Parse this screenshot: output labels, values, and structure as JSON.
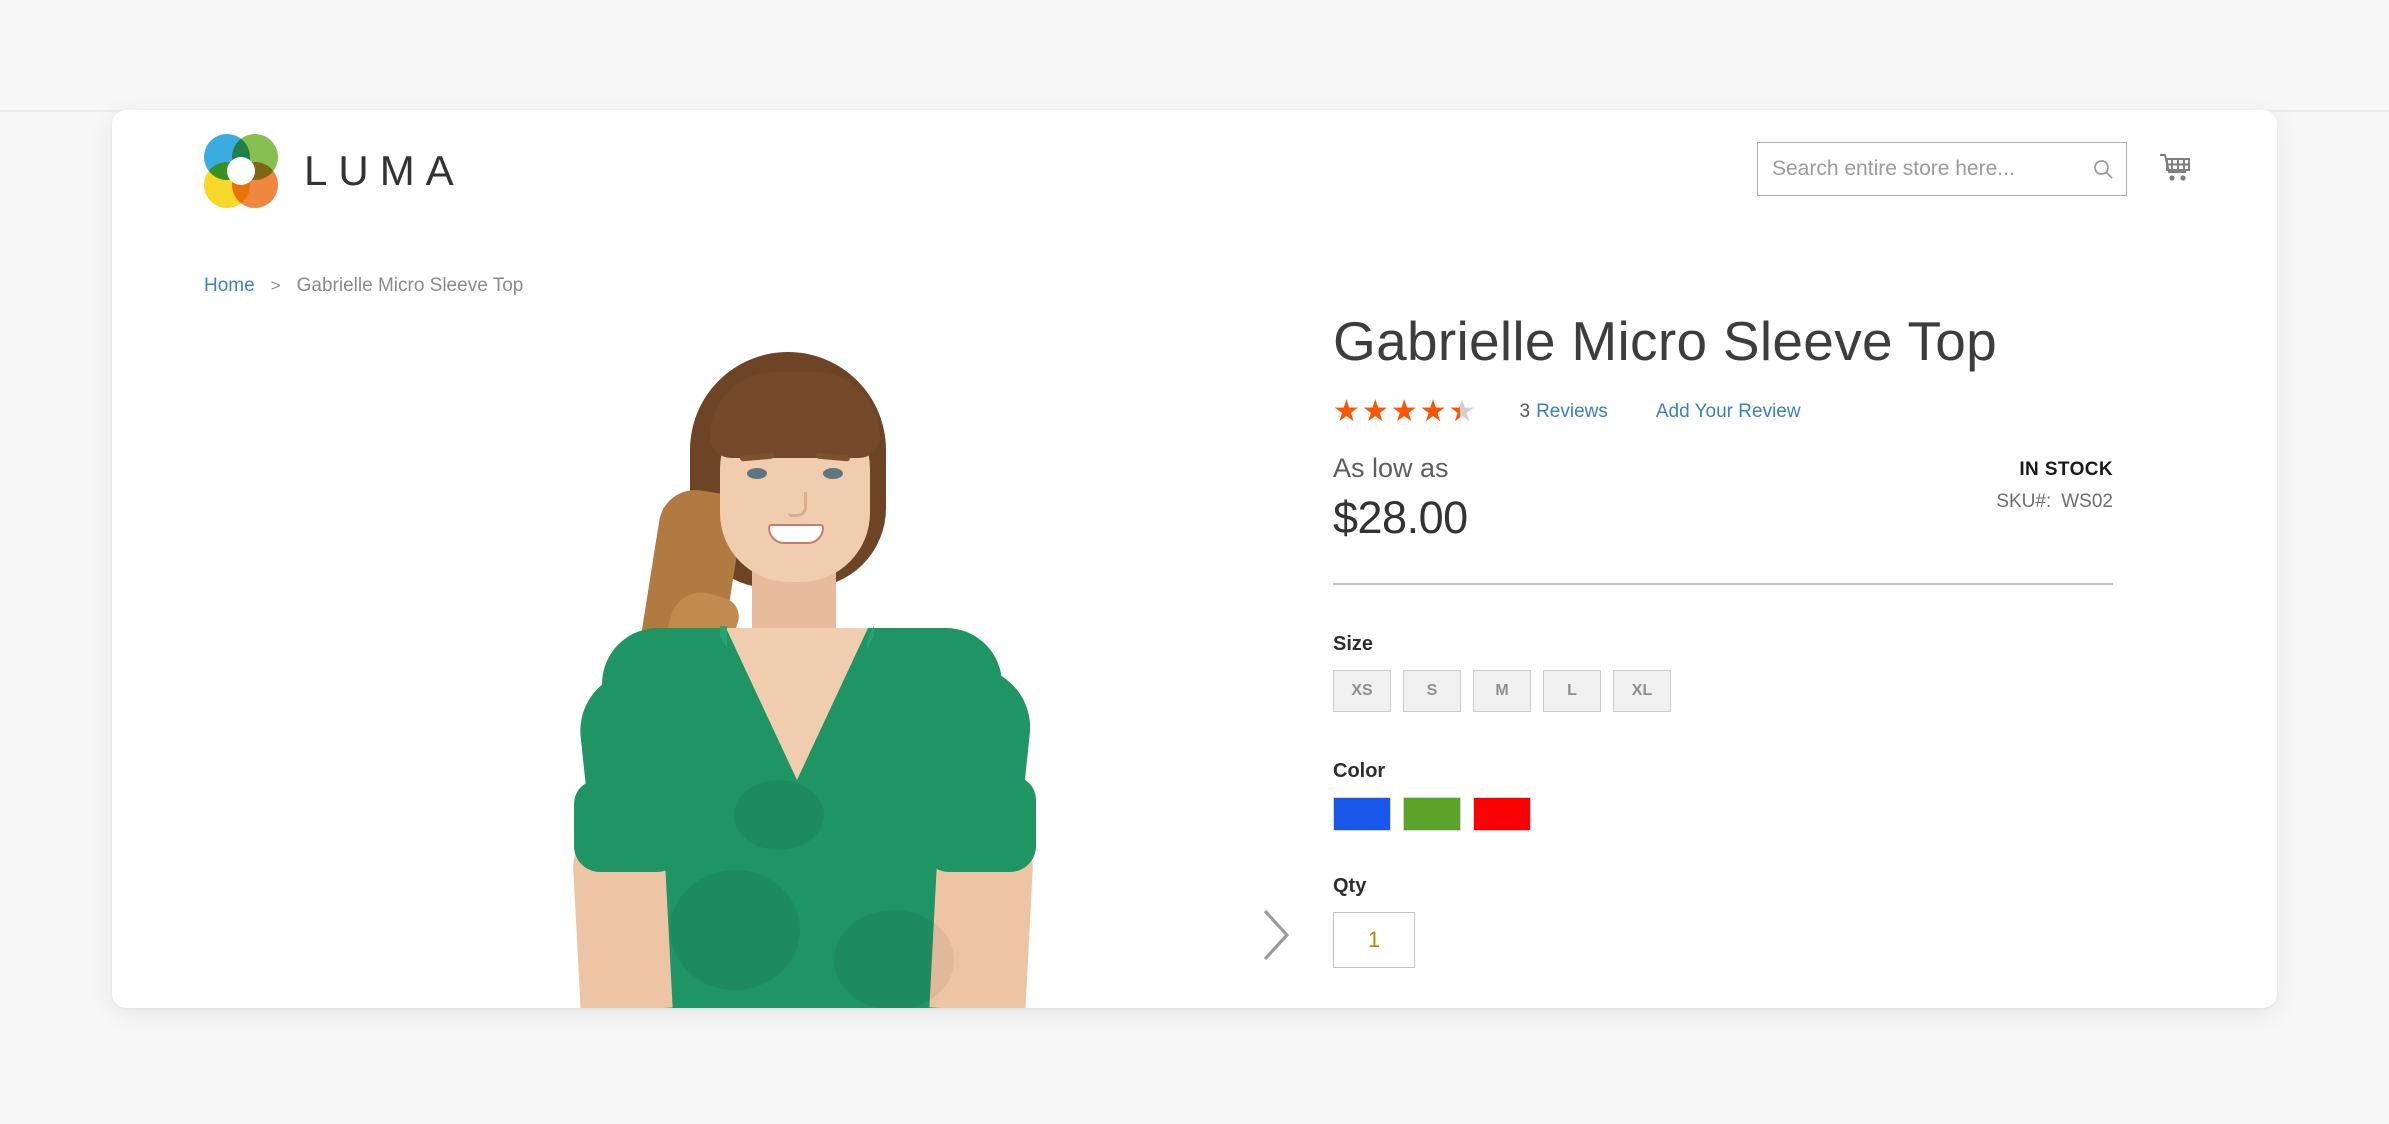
{
  "header": {
    "brand_name": "LUMA",
    "logo_colors": {
      "blue": "#2ba6df",
      "green": "#7ebb42",
      "yellow": "#f7d417",
      "orange": "#ef7e31"
    },
    "search": {
      "placeholder": "Search entire store here...",
      "value": ""
    },
    "cart_label": "Shopping Cart"
  },
  "breadcrumb": {
    "home": "Home",
    "separator": ">",
    "current": "Gabrielle Micro Sleeve Top"
  },
  "gallery": {
    "next_label": "Next image",
    "shirt_color": "#1f9464"
  },
  "product": {
    "title": "Gabrielle Micro Sleeve Top",
    "rating_percent": 88,
    "stars_glyphs": "★★★★★",
    "review_count": "3",
    "review_label": "Reviews",
    "add_review": "Add Your Review",
    "price_prefix": "As low as",
    "price": "$28.00",
    "stock_status": "IN STOCK",
    "sku_label": "SKU#:",
    "sku_value": "WS02"
  },
  "options": {
    "size_label": "Size",
    "sizes": [
      "XS",
      "S",
      "M",
      "L",
      "XL"
    ],
    "color_label": "Color",
    "colors": [
      {
        "name": "blue",
        "hex": "#1857e8"
      },
      {
        "name": "green",
        "hex": "#5ca329"
      },
      {
        "name": "red",
        "hex": "#fa0000"
      }
    ],
    "qty_label": "Qty",
    "qty_value": "1"
  }
}
